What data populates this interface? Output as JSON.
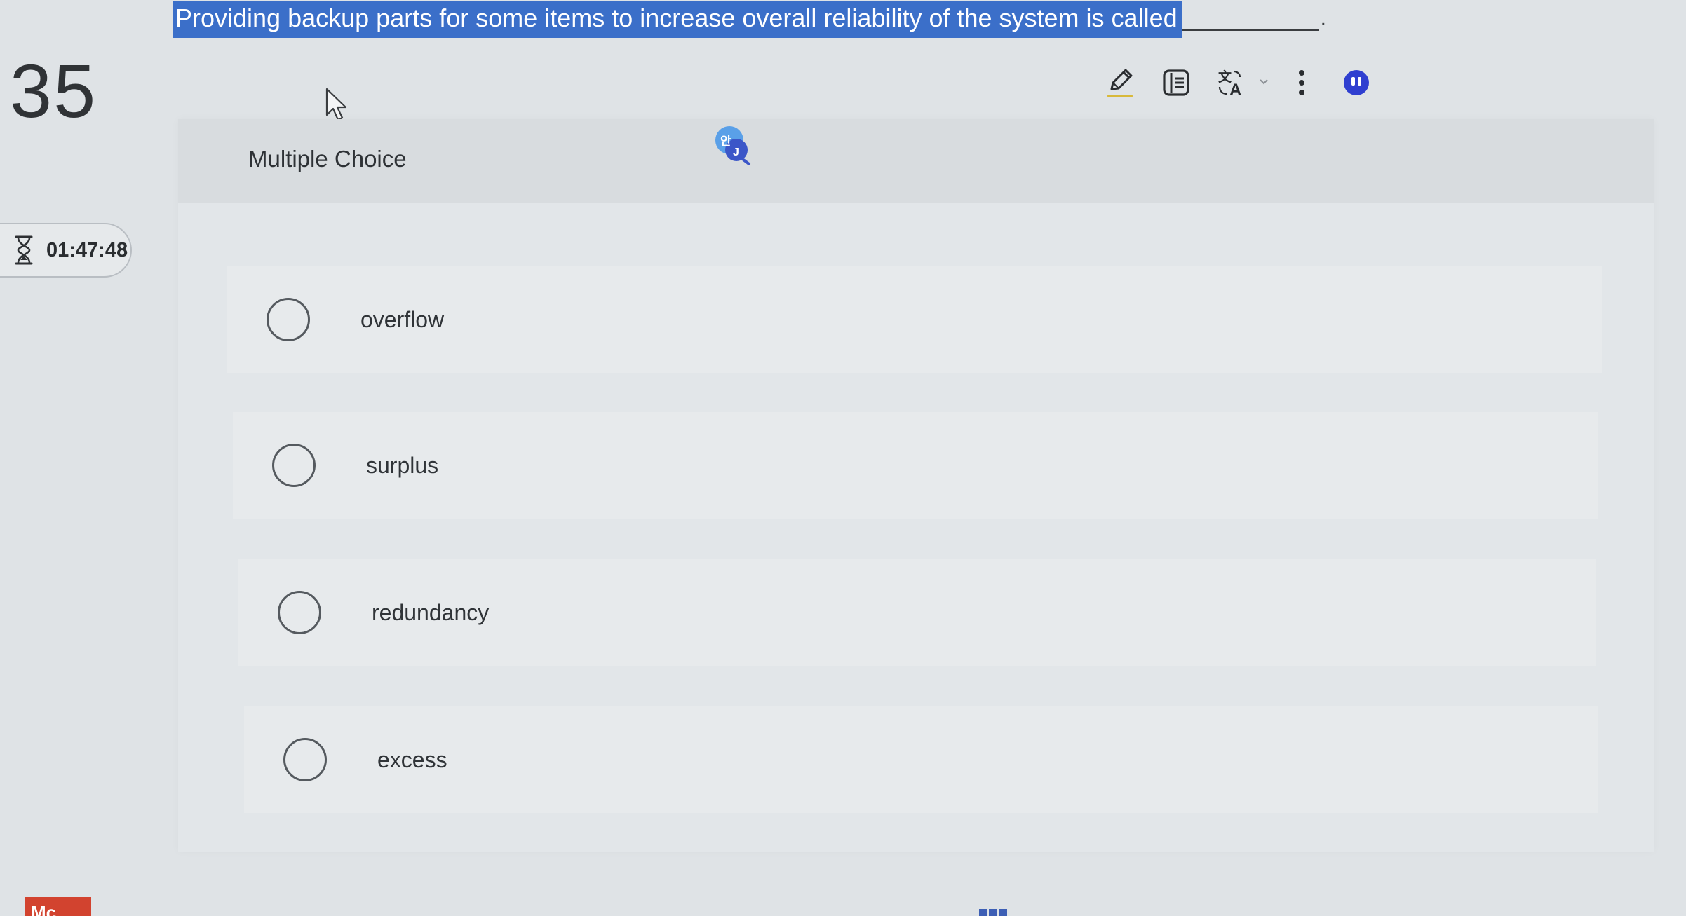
{
  "question": {
    "prompt": "Providing backup parts for some items to increase overall reliability of the system is called",
    "blank_suffix": ".",
    "number": "35",
    "type_label": "Multiple Choice"
  },
  "timer": {
    "value": "01:47:48",
    "icon": "hourglass-icon"
  },
  "toolbar": {
    "icons": [
      "pencil-icon",
      "reader-icon",
      "translate-icon",
      "more-vertical-icon",
      "help-icon"
    ],
    "highlight_color": "#3b6fc9",
    "help_color": "#2f3fd0",
    "pencil_underline_color": "#d8b93a"
  },
  "options": [
    {
      "label": "overflow"
    },
    {
      "label": "surplus"
    },
    {
      "label": "redundancy"
    },
    {
      "label": "excess"
    }
  ],
  "footer": {
    "badge_text": "Mc",
    "badge_color": "#d2432f"
  }
}
